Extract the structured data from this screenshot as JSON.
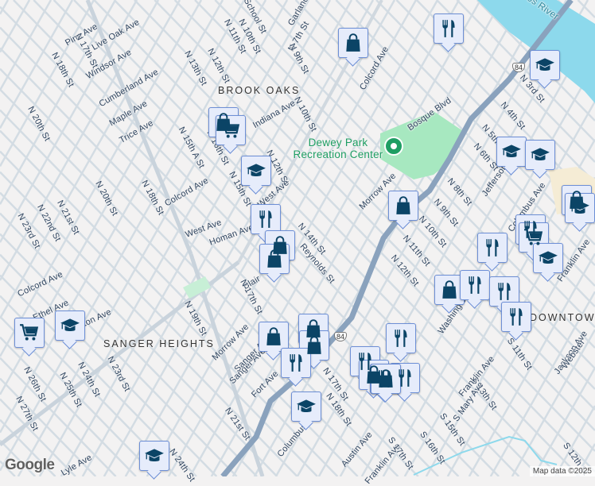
{
  "map": {
    "neighborhoods": [
      "BROOK OAKS",
      "SANGER HEIGHTS",
      "DOWNTOWN"
    ],
    "poi": {
      "name": "Dewey Park Recreation Center",
      "icon": "park-pin-icon"
    },
    "river_label": "os River",
    "highway_shield": "84",
    "street_labels": [
      "Pine Ave",
      "Live Oak Ave",
      "Windsor Ave",
      "Cumberland Ave",
      "Maple Ave",
      "Trice Ave",
      "Colcord Ave",
      "West Ave",
      "N 18th St",
      "N 17th St",
      "N 20th St",
      "N 18th St",
      "N 20th St",
      "N 21st St",
      "N 22nd St",
      "N 23rd St",
      "N 13th St",
      "N 12th St",
      "N 11th St",
      "N 10th St",
      "School St",
      "Garland",
      "N 7th St",
      "N 9th St",
      "N 15th A St",
      "N 16th St",
      "N 15th St",
      "N 12th St",
      "Indiana Ave",
      "West Ave",
      "Colcord Ave",
      "Bosque Blvd",
      "N 10th St",
      "Morrow Ave",
      "N 3rd St",
      "N 4th St",
      "N 5th",
      "N 6th St",
      "Jefferson Ave",
      "N 8th St",
      "N 9th St",
      "N 10th St",
      "Columbus Ave",
      "N 11th St",
      "N 12th St",
      "N 14th St",
      "Reynolds St",
      "Homan Ave",
      "Blair",
      "N 17th St",
      "Colcord Ave",
      "Ethel Ave",
      "Houston Ave",
      "N 19th St",
      "Morrow Ave",
      "Sanger Ave",
      "Fort Ave",
      "N 26th St",
      "N 25th St",
      "N 24th St",
      "N 23rd St",
      "N 27th St",
      "N 21st St",
      "Columbus Ave",
      "N 18th St",
      "Austin Ave",
      "Franklin Ave",
      "S 17th St",
      "S 16th St",
      "S 15th St",
      "S Mary Ave",
      "S 13th St",
      "Franklin Ave",
      "S 11th St",
      "Jackson Ave",
      "Webster",
      "Washington Ave",
      "Franklin Ave",
      "S 12th St",
      "N 17th St",
      "Sanger Ave",
      "Lyle Ave",
      "N 24th St"
    ],
    "markers": [
      "shopping",
      "restaurant",
      "education",
      "shopping",
      "grocery",
      "education",
      "restaurant",
      "shopping",
      "shopping",
      "education",
      "education",
      "shopping",
      "shopping",
      "education",
      "restaurant",
      "grocery",
      "restaurant",
      "education",
      "shopping",
      "restaurant",
      "restaurant",
      "restaurant",
      "grocery",
      "education",
      "shopping",
      "shopping",
      "shopping",
      "restaurant",
      "restaurant",
      "restaurant",
      "restaurant",
      "shopping",
      "restaurant",
      "shopping",
      "education",
      "education"
    ]
  },
  "footer": {
    "logo": "Google",
    "attribution": "Map data ©2025"
  },
  "colors": {
    "land": "#f3f2f2",
    "street": "#d3dce3",
    "highway": "#8aa2bd",
    "water": "#8dd9ec",
    "park": "#a7e8c0",
    "marker_bg": "#e6ecfb",
    "icon": "#0b4466"
  }
}
